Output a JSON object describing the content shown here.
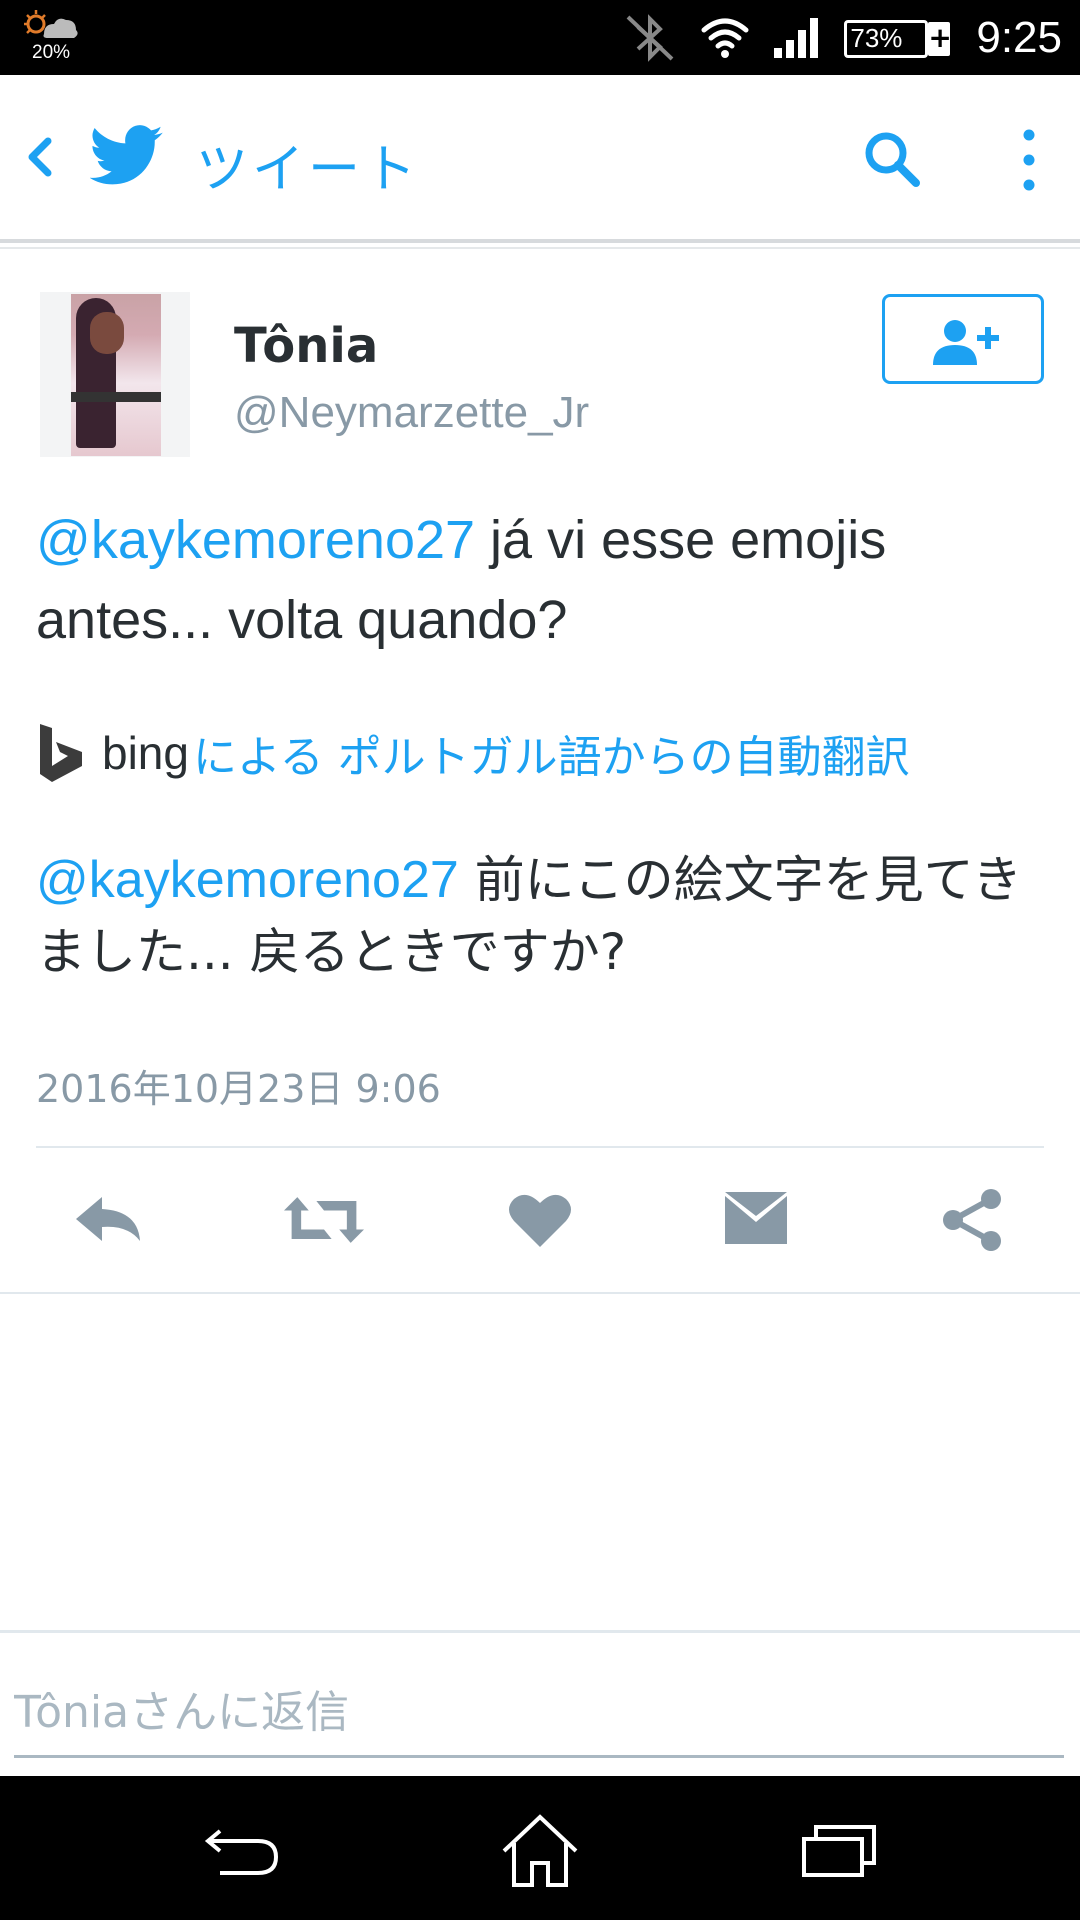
{
  "status_bar": {
    "weather_temp": "20%",
    "battery": "73%",
    "time": "9:25"
  },
  "header": {
    "title": "ツイート"
  },
  "tweet": {
    "display_name": "Tônia",
    "handle": "@Neymarzette_Jr",
    "mention": "@kaykemoreno27",
    "text": " já vi esse emojis antes... volta quando?",
    "translation": {
      "provider": "bing",
      "label": "による ポルトガル語からの自動翻訳"
    },
    "translated_mention": "@kaykemoreno27",
    "translated_text": " 前にこの絵文字を見てきました... 戻るときですか?",
    "timestamp": "2016年10月23日 9:06"
  },
  "reply": {
    "placeholder": "Tôniaさんに返信"
  },
  "colors": {
    "accent": "#1da1f2",
    "muted": "#8899a6",
    "icon_gray": "#8899a6"
  }
}
